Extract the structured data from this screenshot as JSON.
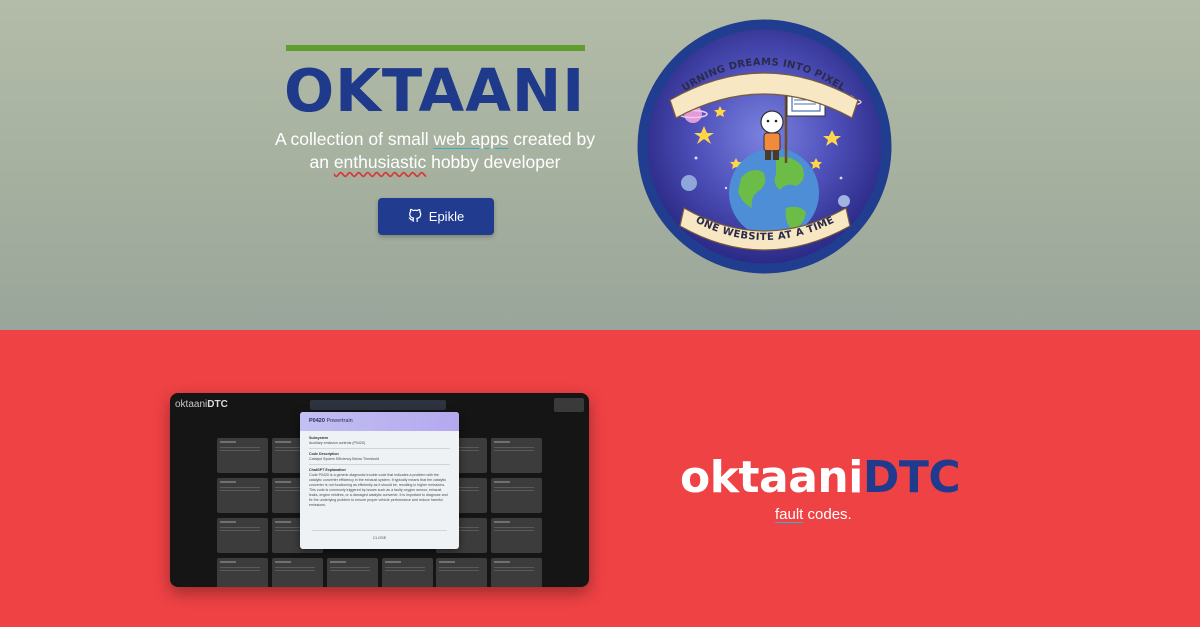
{
  "hero": {
    "title": "OKTAANI",
    "tagline_pre": "A collection of small ",
    "tagline_link": "web apps",
    "tagline_mid": " created by an ",
    "tagline_misspelled": "enthusiastic",
    "tagline_post": " hobby developer",
    "button_label": "Epikle",
    "button_icon": "github-icon",
    "badge": {
      "top_text": "TURNING DREAMS INTO PIXELS",
      "bottom_text": "ONE WEBSITE AT A TIME"
    }
  },
  "promo": {
    "product_name_part1": "oktaani",
    "product_name_part2": "DTC",
    "product_sub_underlined": "fault",
    "product_sub_rest": " codes.",
    "screenshot": {
      "logo_part1": "oktaani",
      "logo_part2": "DTC",
      "modal_code": "P0420",
      "modal_head_suffix": "Powertrain",
      "subsystem_label": "Subsystem",
      "subsystem_value": "Auxiliary emission controls (P0420)",
      "desc_label": "Code Description",
      "desc_value": "Catalyst System Efficiency Below Threshold",
      "gpt_label": "ChatGPT Explanation",
      "gpt_value": "Code P0420 is a generic diagnostic trouble code that indicates a problem with the catalytic converter efficiency in the exhaust system. It typically means that the catalytic converter is not functioning as efficiently as it should be, resulting in higher emissions. This code is commonly triggered by issues such as a faulty oxygen sensor, exhaust leaks, engine misfires, or a damaged catalytic converter. It is important to diagnose and fix the underlying problem to ensure proper vehicle performance and reduce harmful emissions.",
      "close_label": "CLOSE"
    }
  },
  "colors": {
    "brand_blue": "#1f3a8a",
    "brand_green": "#5d9e2e",
    "promo_red": "#ef4244"
  }
}
